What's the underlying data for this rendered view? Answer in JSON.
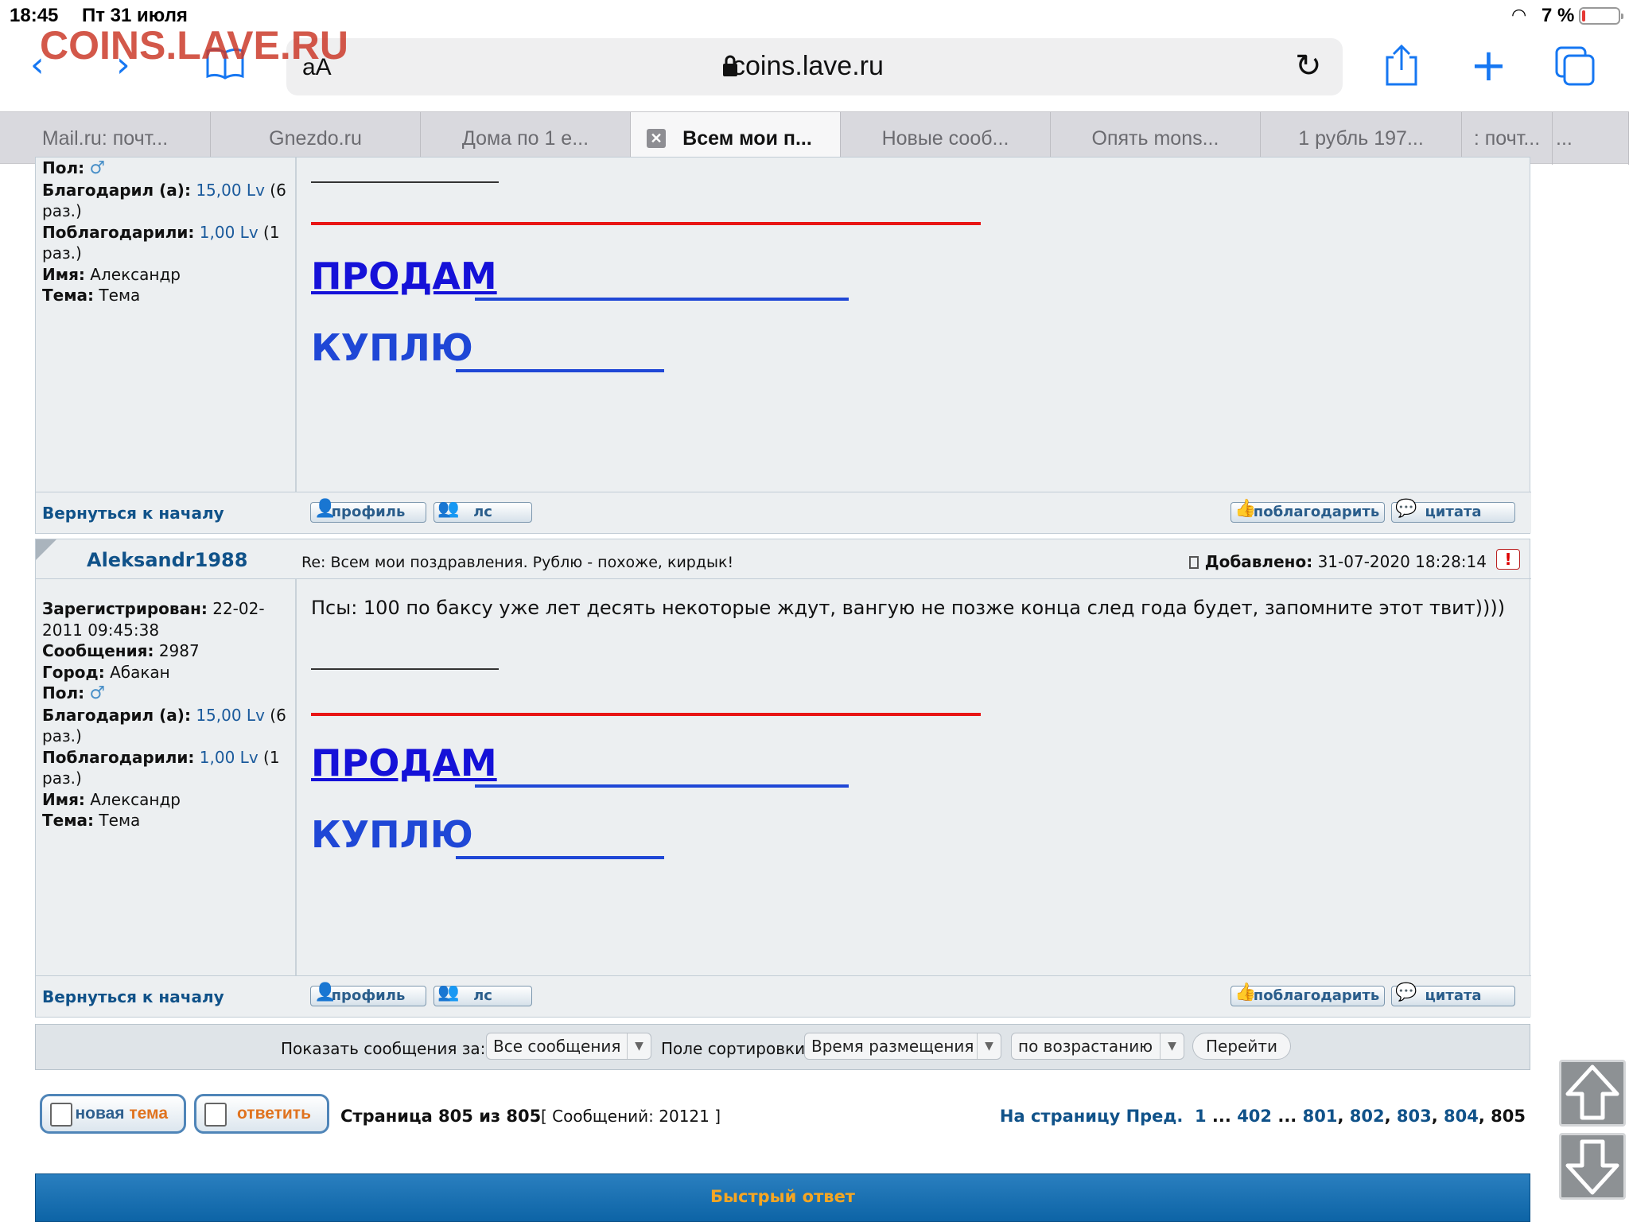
{
  "status": {
    "time": "18:45",
    "date": "Пт 31 июля",
    "battery": "7 %"
  },
  "watermark": "COINS.LAVE.RU",
  "toolbar": {
    "text_size": "аА",
    "url": "coins.lave.ru"
  },
  "tabs": [
    {
      "label": "Mail.ru: почт..."
    },
    {
      "label": "Gnezdo.ru"
    },
    {
      "label": "Дома по 1 е..."
    },
    {
      "label": "Всем мои п..."
    },
    {
      "label": "Новые сооб..."
    },
    {
      "label": "Опять mons..."
    },
    {
      "label": "1 рубль 197..."
    },
    {
      "label": ": почт..."
    },
    {
      "label": "..."
    }
  ],
  "post1": {
    "gender_label": "Пол:",
    "thanked_label": "Благодарил (а):",
    "thanked_value": "15,00 Lv",
    "thanked_count": "(6",
    "thanked_count2": "раз.)",
    "received_label": "Поблагодарили:",
    "received_value": "1,00 Lv",
    "received_count": "(1",
    "received_count2": "раз.)",
    "name_label": "Имя:",
    "name_value": "Александр",
    "theme_label": "Тема:",
    "theme_value": "Тема",
    "sell": "ПРОДАМ",
    "buy": "КУПЛЮ"
  },
  "footer": {
    "back_to_top": "Вернуться к началу",
    "profile": "профиль",
    "pm": "лс",
    "thank": "поблагодарить",
    "quote": "цитата"
  },
  "post2": {
    "author": "Aleksandr1988",
    "subject": "Re: Всем мои поздравления. Рублю - похоже, кирдык!",
    "added_label": "Добавлено:",
    "added_value": "31-07-2020 18:28:14",
    "registered_label": "Зарегистрирован:",
    "registered_value": "22-02-",
    "registered_value2": "2011 09:45:38",
    "posts_label": "Сообщения:",
    "posts_value": "2987",
    "city_label": "Город:",
    "city_value": "Абакан",
    "gender_label": "Пол:",
    "thanked_label": "Благодарил (а):",
    "thanked_value": "15,00 Lv",
    "thanked_count": "(6",
    "thanked_count2": "раз.)",
    "received_label": "Поблагодарили:",
    "received_value": "1,00 Lv",
    "received_count": "(1",
    "received_count2": "раз.)",
    "name_label": "Имя:",
    "name_value": "Александр",
    "theme_label": "Тема:",
    "theme_value": "Тема",
    "text": "Псы: 100 по баксу уже лет десять некоторые ждут, вангую не позже конца след года будет, запомните этот твит))))",
    "sell": "ПРОДАМ",
    "buy": "КУПЛЮ"
  },
  "sort": {
    "show_label": "Показать сообщения за:",
    "show_value": "Все сообщения",
    "field_label": "Поле сортировки",
    "field_value": "Время размещения",
    "order_value": "по возрастанию",
    "go": "Перейти"
  },
  "pagination": {
    "new_topic_a": "новая",
    "new_topic_b": "тема",
    "reply": "ответить",
    "page_info": "Страница 805 из 805",
    "msg_count": "[ Сообщений: 20121 ]",
    "to_page": "На страницу",
    "prev": "Пред.",
    "pages": [
      "1",
      "402",
      "801",
      "802",
      "803",
      "804"
    ],
    "current": "805"
  },
  "quick_reply": {
    "title": "Быстрый ответ"
  }
}
